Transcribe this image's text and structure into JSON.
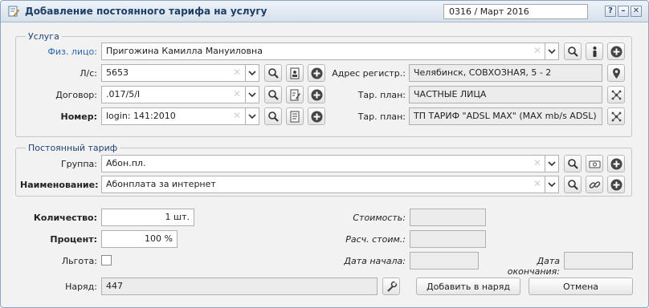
{
  "window": {
    "title": "Добавление постоянного тарифа на услугу",
    "period": "0316 / Март 2016",
    "help_label": "?",
    "minimize_label": "–",
    "close_label": "✕"
  },
  "service": {
    "legend": "Услуга",
    "person": {
      "label": "Физ. лицо:",
      "value": "Пригожина Камилла Мануиловна"
    },
    "account": {
      "label": "Л/с:",
      "value": "5653"
    },
    "contract": {
      "label": "Договор:",
      "value": ".017/5/I"
    },
    "number": {
      "label": "Номер:",
      "value": "login: 141:2010"
    },
    "address": {
      "label": "Адрес регистр.:",
      "value": "Челябинск, СОВХОЗНАЯ, 5 - 2"
    },
    "tariff_plan_1": {
      "label": "Тар. план:",
      "value": "ЧАСТНЫЕ ЛИЦА"
    },
    "tariff_plan_2": {
      "label": "Тар. план:",
      "value": "ТП ТАРИФ \"ADSL MAX\" (MAX mb/s ADSL)"
    }
  },
  "tariff": {
    "legend": "Постоянный тариф",
    "group": {
      "label": "Группа:",
      "value": "Абон.пл."
    },
    "name": {
      "label": "Наименование:",
      "value": "Абонплата за интернет"
    }
  },
  "details": {
    "quantity": {
      "label": "Количество:",
      "value": "1 шт."
    },
    "percent": {
      "label": "Процент:",
      "value": "100 %"
    },
    "benefit": {
      "label": "Льгота:",
      "checked": false
    },
    "cost": {
      "label": "Стоимость:",
      "value": ""
    },
    "calc_cost": {
      "label": "Расч. стоим.:",
      "value": ""
    },
    "start_date": {
      "label": "Дата начала:",
      "value": ""
    },
    "end_date": {
      "label": "Дата окончания:",
      "value": ""
    },
    "order": {
      "label": "Наряд:",
      "value": "447"
    }
  },
  "buttons": {
    "add_to_order": "Добавить в наряд",
    "cancel": "Отмена"
  },
  "colors": {
    "accent": "#1e3e66",
    "link": "#2b66b4",
    "border": "#b0b0b0"
  }
}
